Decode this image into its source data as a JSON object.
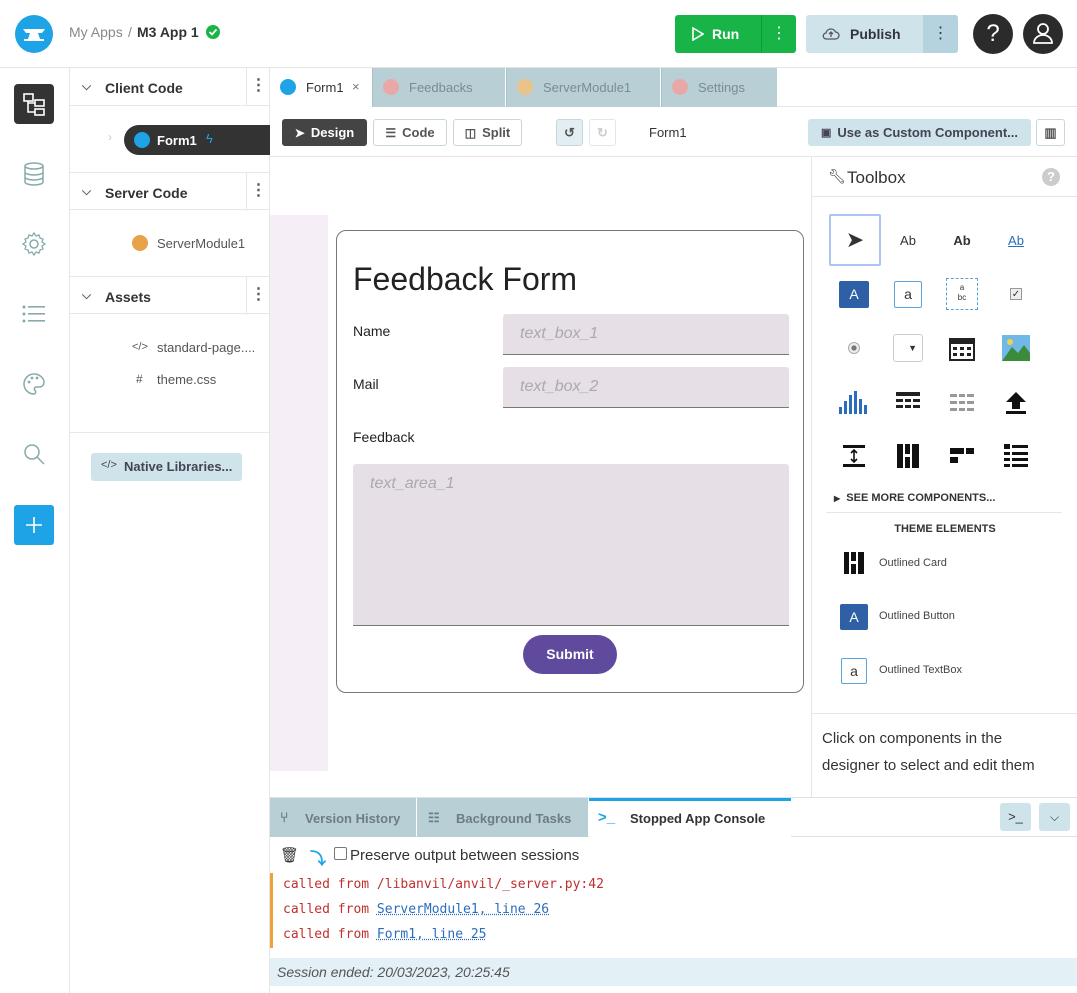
{
  "header": {
    "breadcrumb_root": "My Apps",
    "separator": "/",
    "app_name": "M3 App 1",
    "run_label": "Run",
    "publish_label": "Publish",
    "help_label": "?"
  },
  "tree": {
    "client_code": "Client Code",
    "client_items": [
      {
        "label": "Form1"
      }
    ],
    "server_code": "Server Code",
    "server_items": [
      {
        "label": "ServerModule1"
      }
    ],
    "assets": "Assets",
    "asset_items": [
      {
        "label": "standard-page...."
      },
      {
        "label": "theme.css"
      }
    ],
    "native_libraries": "Native Libraries..."
  },
  "tabs": [
    {
      "label": "Form1",
      "color": "#1ea3e6"
    },
    {
      "label": "Feedbacks",
      "color": "#e08b8b"
    },
    {
      "label": "ServerModule1",
      "color": "#e0b67a"
    },
    {
      "label": "Settings",
      "color": "#e08b8b"
    }
  ],
  "toolbar": {
    "design_label": "Design",
    "code_label": "Code",
    "split_label": "Split",
    "form_name": "Form1",
    "custom_component_label": "Use as Custom Component..."
  },
  "form": {
    "title": "Feedback Form",
    "name_label": "Name",
    "name_placeholder": "text_box_1",
    "mail_label": "Mail",
    "mail_placeholder": "text_box_2",
    "feedback_label": "Feedback",
    "feedback_placeholder": "text_area_1",
    "submit_label": "Submit",
    "submit_color": "#5f4a9e"
  },
  "toolbox": {
    "title": "Toolbox",
    "labels": [
      "Ab",
      "Ab",
      "Ab"
    ],
    "button_glyph": "A",
    "textbox_glyph": "a",
    "see_more": "SEE MORE COMPONENTS...",
    "theme_elements": "THEME ELEMENTS",
    "theme_items": [
      {
        "label": "Outlined Card"
      },
      {
        "label": "Outlined Button"
      },
      {
        "label": "Outlined TextBox"
      }
    ],
    "hint": "Click on components in the designer to select and edit them"
  },
  "bottom": {
    "tabs": [
      {
        "label": "Version History"
      },
      {
        "label": "Background Tasks"
      },
      {
        "label": "Stopped App Console"
      }
    ],
    "preserve_label": "Preserve output between sessions",
    "lines": [
      {
        "prefix": "called from /libanvil/anvil/_server.py:42",
        "link": ""
      },
      {
        "prefix": "called from ",
        "link": "ServerModule1, line 26"
      },
      {
        "prefix": "called from ",
        "link": "Form1, line 25"
      }
    ],
    "session_ended": "Session ended: 20/03/2023, 20:25:45"
  }
}
